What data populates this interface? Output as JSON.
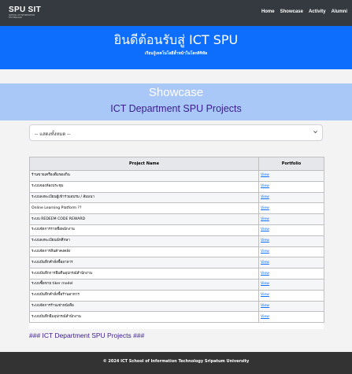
{
  "navbar": {
    "logo_main": "SPU SIT",
    "logo_sub": "SCHOOL OF INFORMATION TECHNOLOGY",
    "links": [
      "Home",
      "Showcase",
      "Activity",
      "Alumni"
    ]
  },
  "hero": {
    "title": "ยินดีต้อนรับสู่ ICT SPU",
    "subtitle": "เรียนรู้เทคโนโลยีล้ำหน้าในโลกดิจิทัล"
  },
  "showcase": {
    "title": "Showcase",
    "subtitle": "ICT Department SPU Projects"
  },
  "filter": {
    "selected": "-- แสดงทั้งหมด --"
  },
  "table": {
    "headers": [
      "Project Name",
      "Portfolio"
    ],
    "rows": [
      {
        "name": "ร้านขายเครื่องดื่มของกิน",
        "link": "View"
      },
      {
        "name": "ระบบจองห้องประชุม",
        "link": "View"
      },
      {
        "name": "ระบบลงทะเบียนผู้เข้าร่วมอบรม / สัมมนา",
        "link": "View"
      },
      {
        "name": "Online Learning Platform ??",
        "link": "View"
      },
      {
        "name": "ระบบ REDEEM CODE REWARD",
        "link": "View"
      },
      {
        "name": "ระบบจัดการรายชื่อพนักงาน",
        "link": "View"
      },
      {
        "name": "ระบบลงทะเบียนนักศึกษา",
        "link": "View"
      },
      {
        "name": "ระบบจัดการสินค้าคงคลัง",
        "link": "View"
      },
      {
        "name": "ระบบบันทึกคำสั่งซื้ออาหาร",
        "link": "View"
      },
      {
        "name": "ระบบบันทึกการยืมคืนอุปกรณ์สำนักงาน",
        "link": "View"
      },
      {
        "name": "ระบบซื้อขาย tiker model",
        "link": "View"
      },
      {
        "name": "ระบบบันทึกคำสั่งซื้อร้านอาหาร",
        "link": "View"
      },
      {
        "name": "ระบบจัดการร้านเช่าหนังสือ",
        "link": "View"
      },
      {
        "name": "ระบบบันทึกยืมอุปกรณ์สำนักงาน",
        "link": "View"
      }
    ]
  },
  "footer_note": "### ICT Department SPU Projects ###",
  "footer": {
    "text": "© 2024 ICT School of Information Technology Sripatum University"
  },
  "colors": {
    "navbar": "#343a40",
    "hero": "#0d6efd",
    "showcase_banner": "#a9c7f7",
    "accent_text": "#3b1d8f",
    "footer": "#333333"
  }
}
